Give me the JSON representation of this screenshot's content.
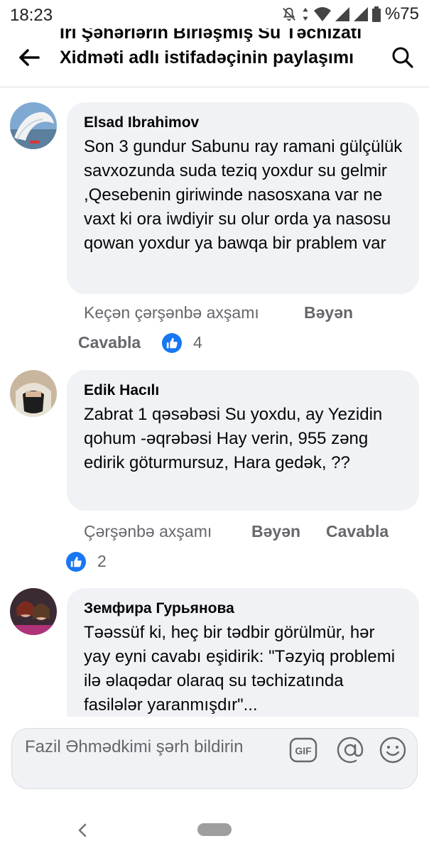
{
  "status_bar": {
    "time": "18:23",
    "battery": "%75"
  },
  "header": {
    "title": "Iri Şəhərlərin Birləşmiş Su Təchizatı Xidməti adlı istifadəçinin paylaşımı"
  },
  "comments": [
    {
      "author": "Elsad  Ibrahimov",
      "text": "Son 3 gundur Sabunu ray ramani gülçülük savxozunda suda teziq yoxdur su gelmir ,Qesebenin giriwinde nasosxana var ne vaxt ki ora iwdiyir su olur orda ya nasosu qowan yoxdur ya bawqa bir prablem var",
      "time": "Keçən çərşənbə axşamı",
      "like_label": "Bəyən",
      "reply_label": "Cavabla",
      "likes": "4"
    },
    {
      "author": "Edik Hacılı",
      "text": "Zabrat 1 qəsəbəsi Su yoxdu,  ay Yezidin qohum -əqrəbəsi Hay verin, 955 zəng edirik göturmursuz,  Hara gedək, ??",
      "time": "Çərşənbə axşamı",
      "like_label": "Bəyən",
      "reply_label": "Cavabla",
      "likes": "2"
    },
    {
      "author": "Земфира Гурьянова",
      "text": "Təəssüf ki, heç bir tədbir görülmür, hər yay eyni cavabı eşidirik: \"Təzyiq problemi ilə əlaqədar olaraq su təchizatında fasilələr yaranmışdır\"..."
    }
  ],
  "composer": {
    "placeholder": "Fazil Əhmədkimi şərh bildirin"
  },
  "colors": {
    "like_blue": "#1877f2",
    "bubble_bg": "#f0f2f5",
    "meta_gray": "#65676b"
  },
  "icons": {
    "back": "arrow-left-icon",
    "search": "search-icon",
    "like": "thumbs-up-icon",
    "gif": "gif-icon",
    "mention": "at-sign-icon",
    "emoji": "smiley-icon"
  }
}
